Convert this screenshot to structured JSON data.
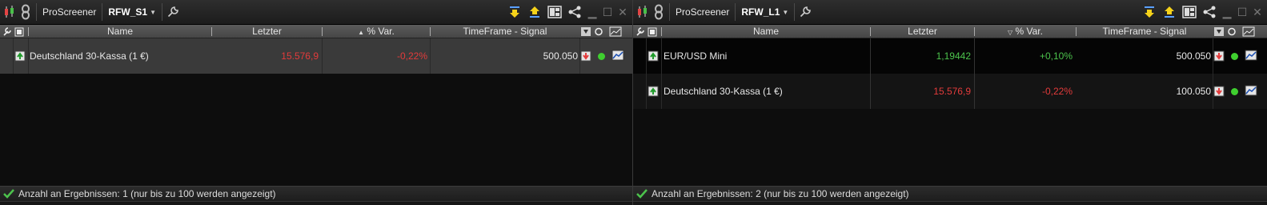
{
  "panes": [
    {
      "brand": "ProScreener",
      "list_name": "RFW_S1",
      "columns": {
        "name": "Name",
        "last": "Letzter",
        "var": "% Var.",
        "signal": "TimeFrame - Signal"
      },
      "sort_indicator": "up",
      "rows": [
        {
          "name": "Deutschland 30-Kassa (1 €)",
          "last": "15.576,9",
          "var": "-0,22%",
          "signal": "500.050",
          "trend": "up",
          "color": "red",
          "signal_icon": "down",
          "selected": true
        }
      ],
      "status": "Anzahl an Ergebnissen: 1 (nur bis zu 100 werden angezeigt)"
    },
    {
      "brand": "ProScreener",
      "list_name": "RFW_L1",
      "columns": {
        "name": "Name",
        "last": "Letzter",
        "var": "% Var.",
        "signal": "TimeFrame - Signal"
      },
      "sort_indicator": "down",
      "rows": [
        {
          "name": "EUR/USD Mini",
          "last": "1,19442",
          "var": "+0,10%",
          "signal": "500.050",
          "trend": "up",
          "color": "green",
          "signal_icon": "down",
          "selected": false
        },
        {
          "name": "Deutschland 30-Kassa (1 €)",
          "last": "15.576,9",
          "var": "-0,22%",
          "signal": "100.050",
          "trend": "up",
          "color": "red",
          "signal_icon": "down",
          "selected": false
        }
      ],
      "status": "Anzahl an Ergebnissen: 2 (nur bis zu 100 werden angezeigt)"
    }
  ],
  "colors": {
    "accent_red": "#e33b3b",
    "accent_green": "#4cc34c",
    "status_dot": "#3fcf2f"
  }
}
